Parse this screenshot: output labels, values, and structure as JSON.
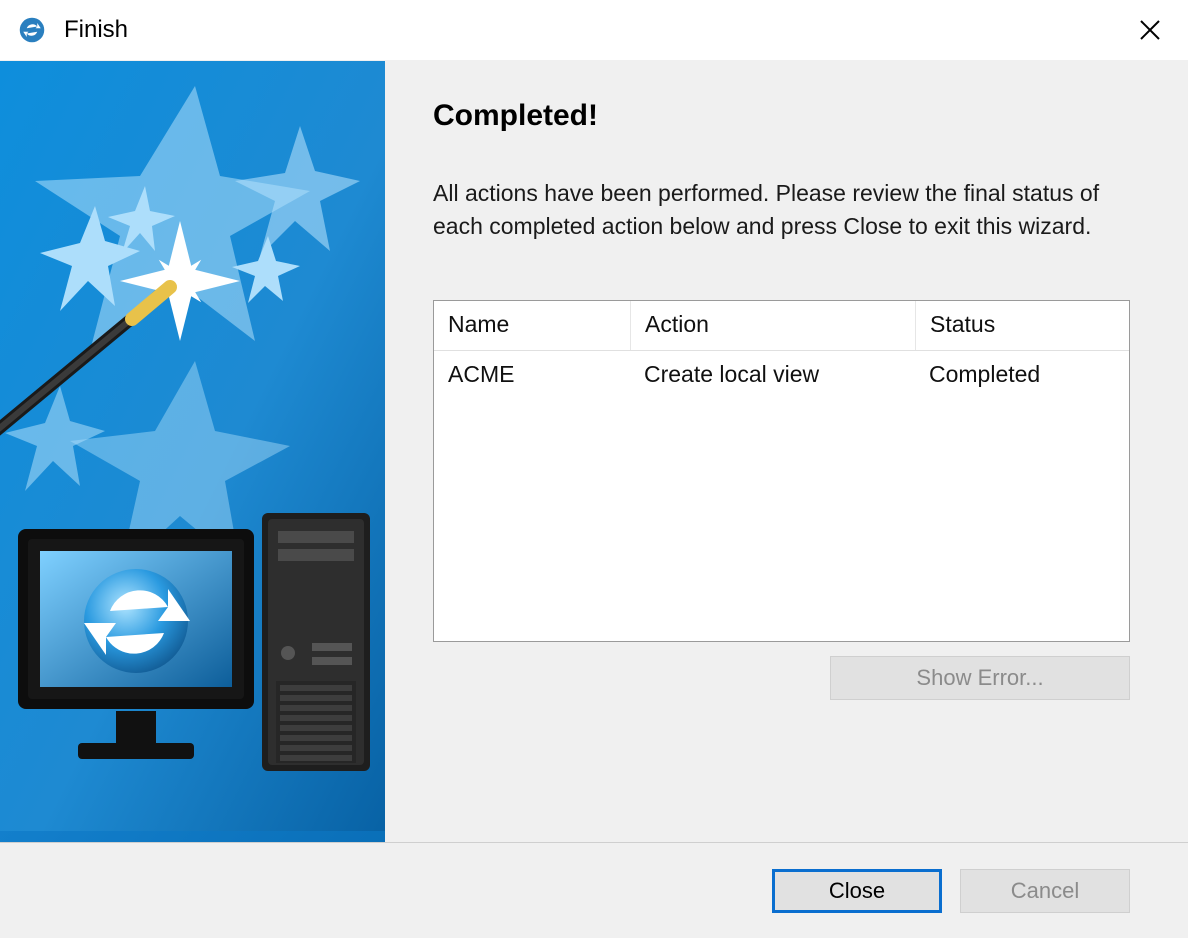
{
  "title": "Finish",
  "heading": "Completed!",
  "description": "All actions have been performed. Please review the final status of each completed action below and press Close to exit this wizard.",
  "table": {
    "headers": {
      "name": "Name",
      "action": "Action",
      "status": "Status"
    },
    "rows": [
      {
        "name": "ACME",
        "action": "Create local view",
        "status": "Completed"
      }
    ]
  },
  "buttons": {
    "show_error": "Show Error...",
    "close": "Close",
    "cancel": "Cancel"
  }
}
